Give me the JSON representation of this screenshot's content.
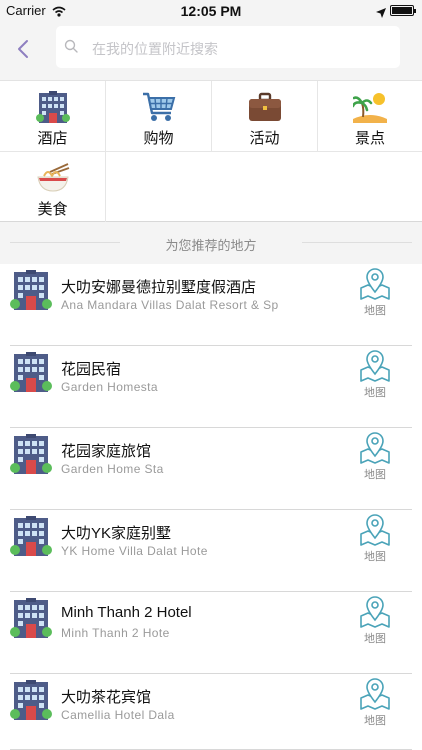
{
  "status_bar": {
    "carrier": "Carrier",
    "time": "12:05 PM"
  },
  "header": {
    "back_icon": "chevron-left-icon",
    "search_placeholder": "在我的位置附近搜索"
  },
  "categories": [
    {
      "label": "酒店",
      "icon": "hotel-icon"
    },
    {
      "label": "购物",
      "icon": "shopping-cart-icon"
    },
    {
      "label": "活动",
      "icon": "briefcase-icon"
    },
    {
      "label": "景点",
      "icon": "beach-icon"
    },
    {
      "label": "美食",
      "icon": "noodles-icon"
    }
  ],
  "section": {
    "title": "为您推荐的地方"
  },
  "places": [
    {
      "name": "大叻安娜曼德拉别墅度假酒店",
      "subtitle": "Ana Mandara Villas Dalat Resort & Sp",
      "map_label": "地图"
    },
    {
      "name": "花园民宿",
      "subtitle": "Garden Homesta",
      "map_label": "地图"
    },
    {
      "name": "花园家庭旅馆",
      "subtitle": "Garden Home Sta",
      "map_label": "地图"
    },
    {
      "name": "大叻YK家庭别墅",
      "subtitle": "YK Home Villa Dalat Hote",
      "map_label": "地图"
    },
    {
      "name": "Minh Thanh 2 Hotel",
      "subtitle": "Minh Thanh 2 Hote",
      "map_label": "地图"
    },
    {
      "name": "大叻茶花宾馆",
      "subtitle": "Camellia Hotel Dala",
      "map_label": "地图"
    }
  ],
  "colors": {
    "accent": "#4aa3b8",
    "back": "#8e7fc0",
    "divider": "#d8d8d8"
  }
}
